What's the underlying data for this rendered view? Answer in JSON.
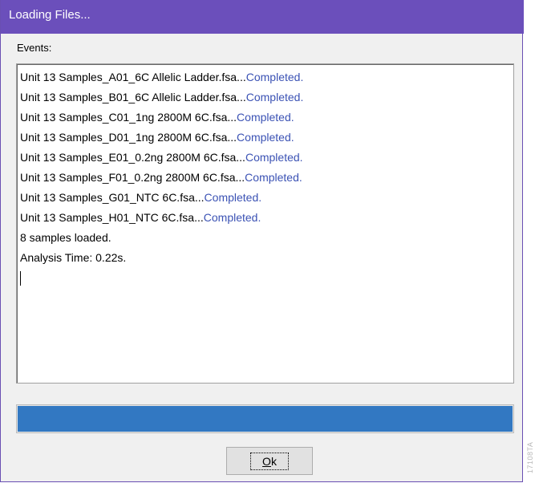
{
  "window": {
    "title": "Loading Files...",
    "colors": {
      "titlebar": "#6b4fbb",
      "status_text": "#3b52b4",
      "progress_fill": "#3278c2"
    }
  },
  "events": {
    "label": "Events:",
    "lines": [
      {
        "file": "Unit 13 Samples_A01_6C Allelic Ladder.fsa...",
        "status": "Completed."
      },
      {
        "file": "Unit 13 Samples_B01_6C Allelic Ladder.fsa...",
        "status": "Completed."
      },
      {
        "file": "Unit 13 Samples_C01_1ng 2800M 6C.fsa...",
        "status": "Completed."
      },
      {
        "file": "Unit 13 Samples_D01_1ng 2800M 6C.fsa...",
        "status": "Completed."
      },
      {
        "file": "Unit 13 Samples_E01_0.2ng 2800M 6C.fsa...",
        "status": "Completed."
      },
      {
        "file": "Unit 13 Samples_F01_0.2ng 2800M 6C.fsa...",
        "status": "Completed."
      },
      {
        "file": "Unit 13 Samples_G01_NTC 6C.fsa...",
        "status": "Completed."
      },
      {
        "file": "Unit 13 Samples_H01_NTC 6C.fsa...",
        "status": "Completed."
      }
    ],
    "summary": "8 samples loaded.",
    "analysis_time": "Analysis Time: 0.22s."
  },
  "progress": {
    "fraction": 1.0
  },
  "buttons": {
    "ok_mnemonic": "O",
    "ok_rest": "k"
  },
  "figure_code": "17108TA"
}
